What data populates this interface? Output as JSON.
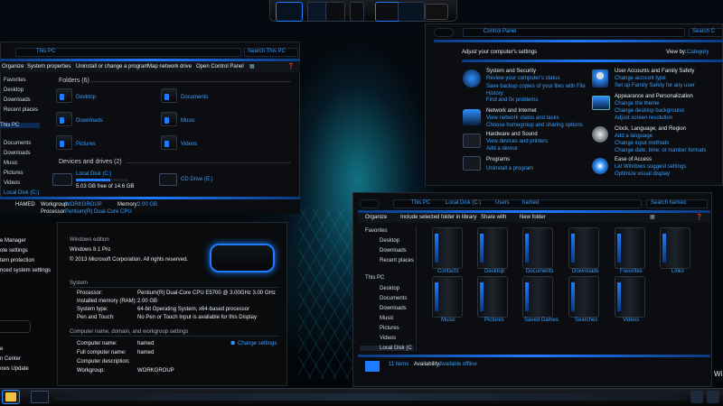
{
  "taskbar_top": {
    "icons": [
      "monitor-app-icon",
      "monitor-app-icon",
      "media-app-icon",
      "tool-icon",
      "folder-app-icon",
      "monitor-app-icon",
      "drive-app-icon"
    ]
  },
  "left_explorer": {
    "address": "This PC",
    "search": "Search This PC",
    "toolbar": [
      "Organize",
      "System properties",
      "Uninstall or change a program",
      "Map network drive",
      "Open Control Panel"
    ],
    "nav": [
      "Favorites",
      "Desktop",
      "Downloads",
      "Recent places",
      "This PC",
      "Documents",
      "Downloads",
      "Music",
      "Pictures",
      "Videos",
      "Local Disk (C:)"
    ],
    "folders_header": "Folders (6)",
    "folders": [
      "Desktop",
      "Documents",
      "Downloads",
      "Music",
      "Pictures",
      "Videos"
    ],
    "drives_header": "Devices and drives (2)",
    "drives": [
      {
        "name": "Local Disk (C:)",
        "free": "5.03 GB free of 14.6 GB",
        "used_fraction": 0.66
      },
      {
        "name": "CD Drive (E:)"
      }
    ],
    "details": {
      "name": "HAMED",
      "workgroup_label": "Workgroup:",
      "workgroup": "WORKGROUP",
      "memory_label": "Memory:",
      "memory": "2.00 GB",
      "processor_label": "Processor:",
      "processor": "Pentium(R) Dual-Core CPU"
    }
  },
  "system_window": {
    "side_links": [
      "e Manager",
      "ote settings",
      "tem protection",
      "nced system settings"
    ],
    "side_bottom": [
      "e",
      "n Center",
      "ows Update"
    ],
    "edition_header": "Windows edition",
    "edition": "Windows 8.1 Pro",
    "copyright": "© 2013 Microsoft Corporation. All rights reserved.",
    "system_header": "System",
    "rows": [
      [
        "Processor:",
        "Pentium(R) Dual-Core  CPU      E5700  @ 3.00GHz   3.00 GHz"
      ],
      [
        "Installed memory (RAM):",
        "2.00 GB"
      ],
      [
        "System type:",
        "64-bit Operating System, x64-based processor"
      ],
      [
        "Pen and Touch:",
        "No Pen or Touch Input is available for this Display"
      ]
    ],
    "name_header": "Computer name, domain, and workgroup settings",
    "name_rows": [
      [
        "Computer name:",
        "hamed"
      ],
      [
        "Full computer name:",
        "hamed"
      ],
      [
        "Computer description:",
        ""
      ],
      [
        "Workgroup:",
        "WORKGROUP"
      ]
    ],
    "change_settings": "Change settings"
  },
  "control_panel": {
    "address": "Control Panel",
    "search": "Search C",
    "heading": "Adjust your computer's settings",
    "view_by": "View by:",
    "view_by_value": "Category",
    "left": [
      {
        "title": "System and Security",
        "links": [
          "Review your computer's status",
          "Save backup copies of your files with File History",
          "Find and fix problems"
        ]
      },
      {
        "title": "Network and Internet",
        "links": [
          "View network status and tasks",
          "Choose homegroup and sharing options"
        ]
      },
      {
        "title": "Hardware and Sound",
        "links": [
          "View devices and printers",
          "Add a device"
        ]
      },
      {
        "title": "Programs",
        "links": [
          "Uninstall a program"
        ]
      }
    ],
    "right": [
      {
        "title": "User Accounts and Family Safety",
        "links": [
          "Change account type",
          "Set up Family Safety for any user"
        ]
      },
      {
        "title": "Appearance and Personalization",
        "links": [
          "Change the theme",
          "Change desktop background",
          "Adjust screen resolution"
        ]
      },
      {
        "title": "Clock, Language, and Region",
        "links": [
          "Add a language",
          "Change input methods",
          "Change date, time, or number formats"
        ]
      },
      {
        "title": "Ease of Access",
        "links": [
          "Let Windows suggest settings",
          "Optimize visual display"
        ]
      }
    ]
  },
  "user_explorer": {
    "breadcrumb": [
      "This PC",
      "Local Disk (C:)",
      "Users",
      "hamed"
    ],
    "search": "Search hamed",
    "toolbar": [
      "Organize",
      "Include selected folder in library",
      "Share with",
      "New folder"
    ],
    "nav": [
      "Favorites",
      "Desktop",
      "Downloads",
      "Recent places",
      "This PC",
      "Desktop",
      "Documents",
      "Downloads",
      "Music",
      "Pictures",
      "Videos",
      "Local Disk (C"
    ],
    "items": [
      "Contacts",
      "Desktop",
      "Documents",
      "Downloads",
      "Favorites",
      "Links",
      "Music",
      "Pictures",
      "Saved Games",
      "Searches",
      "Videos"
    ],
    "status": "11 items",
    "availability_label": "Availability:",
    "availability": "Available offline"
  },
  "corner_text": "Wi"
}
